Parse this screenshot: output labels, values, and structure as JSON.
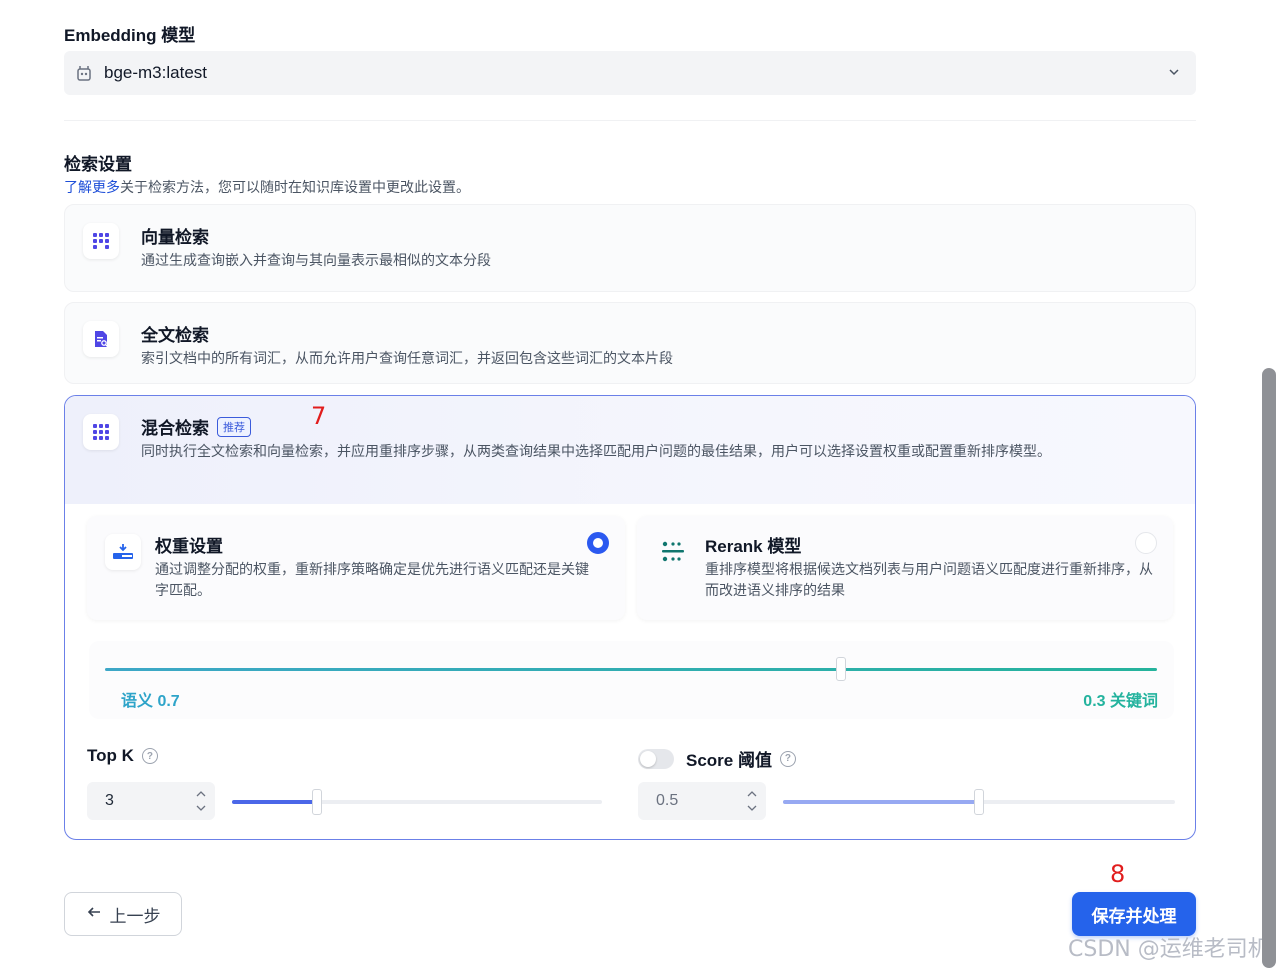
{
  "embedding": {
    "label": "Embedding 模型",
    "value": "bge-m3:latest",
    "icon": "model-icon"
  },
  "retrieval": {
    "title": "检索设置",
    "hint_link": "了解更多",
    "hint_text": "关于检索方法，您可以随时在知识库设置中更改此设置。",
    "options": [
      {
        "title": "向量检索",
        "desc": "通过生成查询嵌入并查询与其向量表示最相似的文本分段",
        "icon": "grid-icon"
      },
      {
        "title": "全文检索",
        "desc": "索引文档中的所有词汇，从而允许用户查询任意词汇，并返回包含这些词汇的文本片段",
        "icon": "document-search-icon"
      },
      {
        "title": "混合检索",
        "badge": "推荐",
        "desc": "同时执行全文检索和向量检索，并应用重排序步骤，从两类查询结果中选择匹配用户问题的最佳结果，用户可以选择设置权重或配置重新排序模型。",
        "icon": "grid-icon",
        "selected": true
      }
    ],
    "hybrid": {
      "weight": {
        "title": "权重设置",
        "desc": "通过调整分配的权重，重新排序策略确定是优先进行语义匹配还是关键字匹配。",
        "selected": true
      },
      "rerank": {
        "title": "Rerank 模型",
        "desc": "重排序模型将根据候选文档列表与用户问题语义匹配度进行重新排序，从而改进语义排序的结果",
        "selected": false
      },
      "semantic_label": "语义 0.7",
      "keyword_label": "0.3 关键词",
      "semantic_weight": 0.7,
      "topk": {
        "label": "Top K",
        "value": "3",
        "slider_fraction": 0.23
      },
      "score": {
        "label": "Score 阈值",
        "value": "0.5",
        "enabled": false,
        "slider_fraction": 0.5
      }
    }
  },
  "actions": {
    "back": "上一步",
    "save": "保存并处理"
  },
  "annotations": {
    "a7": "7",
    "a8": "8"
  },
  "watermark": "CSDN @运维老司机",
  "colors": {
    "primary": "#2563eb",
    "accent_border": "#6b80e8",
    "semantic": "#2ea4c9",
    "keyword": "#24b39e"
  }
}
